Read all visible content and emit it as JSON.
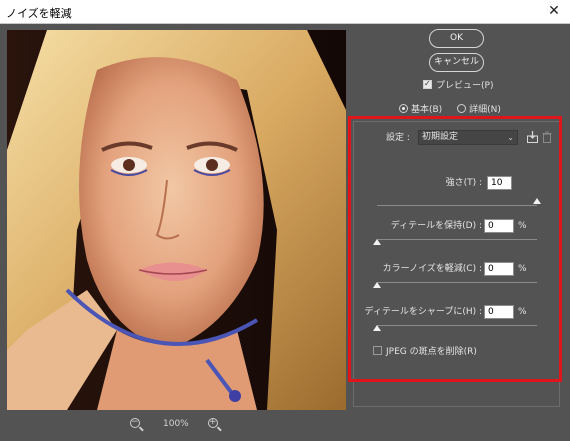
{
  "window": {
    "title": "ノイズを軽減",
    "close_glyph": "✕"
  },
  "preview": {
    "zoom_out_icon": "zoom-out-icon",
    "zoom_level": "100%",
    "zoom_in_icon": "zoom-in-icon"
  },
  "buttons": {
    "ok": "OK",
    "cancel": "キャンセル"
  },
  "preview_checkbox": {
    "label": "プレビュー(P)",
    "checked": true
  },
  "mode": {
    "basic": "基本(B)",
    "advanced": "詳細(N)",
    "selected": "basic"
  },
  "settings": {
    "label": "設定 :",
    "preset": "初期設定",
    "save_icon": "save-preset-icon",
    "delete_icon": "trash-icon"
  },
  "controls": {
    "strength": {
      "label": "強さ(T) :",
      "value": "10",
      "max": 10
    },
    "preserve_details": {
      "label": "ディテールを保持(D) :",
      "value": "0",
      "unit": "%",
      "max": 100
    },
    "reduce_color_noise": {
      "label": "カラーノイズを軽減(C) :",
      "value": "0",
      "unit": "%",
      "max": 100
    },
    "sharpen_details": {
      "label": "ディテールをシャープに(H) :",
      "value": "0",
      "unit": "%",
      "max": 100
    }
  },
  "jpeg_checkbox": {
    "label": "JPEG の斑点を削除(R)",
    "checked": false
  },
  "colors": {
    "dialog_bg": "#535353",
    "highlight": "#e0141b"
  }
}
